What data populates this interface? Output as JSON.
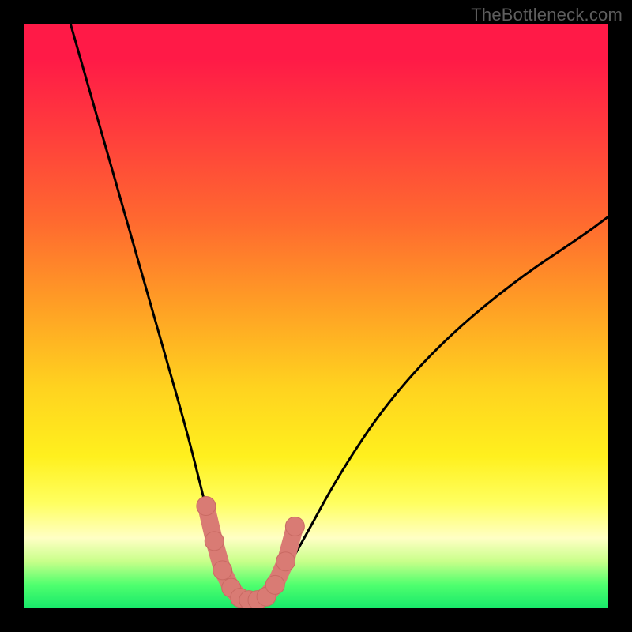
{
  "watermark": {
    "text": "TheBottleneck.com"
  },
  "colors": {
    "frame": "#000000",
    "curve_stroke": "#000000",
    "marker_fill": "#d97b74",
    "marker_stroke": "#c96a63",
    "gradient_stops": [
      "#ff1a47",
      "#ff3b3d",
      "#ff6a2f",
      "#ff9e25",
      "#ffd21f",
      "#fff01e",
      "#ffff60",
      "#ffffc5",
      "#c8ff8a",
      "#4fff6e",
      "#17e86a"
    ]
  },
  "chart_data": {
    "type": "line",
    "title": "",
    "xlabel": "",
    "ylabel": "",
    "xlim": [
      0,
      100
    ],
    "ylim": [
      0,
      100
    ],
    "grid": false,
    "legend": false,
    "series": [
      {
        "name": "bottleneck-curve",
        "x": [
          8,
          12,
          16,
          20,
          24,
          28,
          31,
          33,
          35,
          36.5,
          38,
          40,
          42,
          44,
          48,
          54,
          62,
          72,
          84,
          96,
          100
        ],
        "y": [
          100,
          86,
          72,
          58,
          44,
          30,
          18,
          10,
          5,
          2.5,
          1.5,
          1.5,
          2.5,
          5,
          12,
          23,
          35,
          46,
          56,
          64,
          67
        ]
      }
    ],
    "markers": {
      "name": "highlight-points",
      "x": [
        31.2,
        32.6,
        34.0,
        35.5,
        37.0,
        38.5,
        40.0,
        41.5,
        43.0,
        44.8,
        46.4
      ],
      "y": [
        17.5,
        11.5,
        6.5,
        3.5,
        1.8,
        1.4,
        1.4,
        2.0,
        4.0,
        8.0,
        14.0
      ]
    }
  }
}
